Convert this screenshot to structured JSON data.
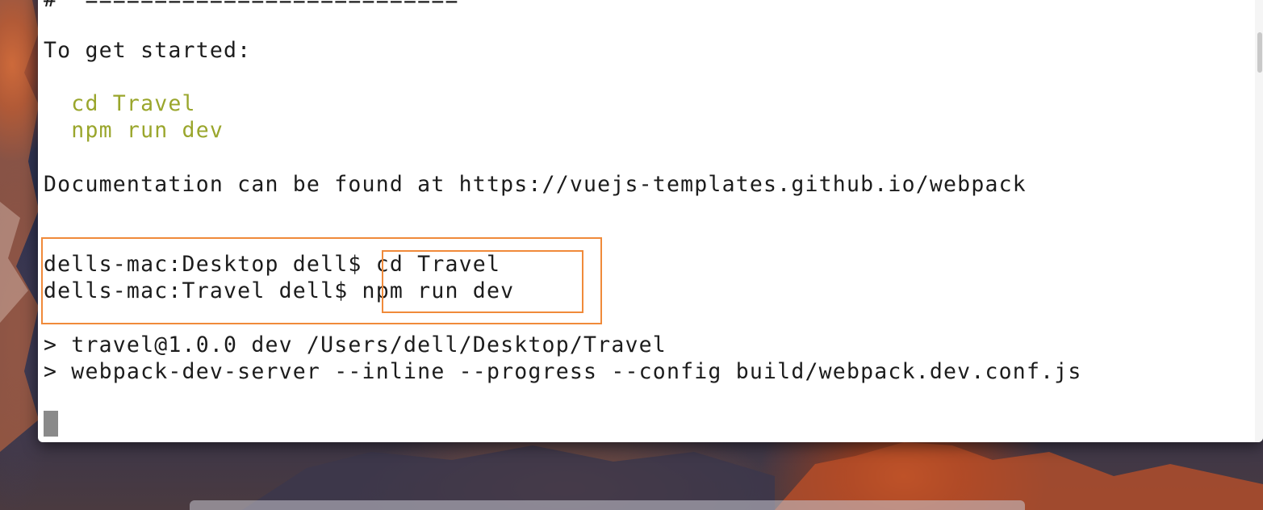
{
  "terminal": {
    "lines": [
      "#  ===========================",
      "To get started:",
      "  cd Travel",
      "  npm run dev",
      "Documentation can be found at https://vuejs-templates.github.io/webpack",
      "dells-mac:Desktop dell$ cd Travel",
      "dells-mac:Travel dell$ npm run dev",
      "> travel@1.0.0 dev /Users/dell/Desktop/Travel",
      "> webpack-dev-server --inline --progress --config build/webpack.dev.conf.js"
    ]
  },
  "colors": {
    "terminal_background": "#ffffff",
    "text": "#1c1c1c",
    "command_hint_green": "#9aa62c",
    "annotation_orange": "#f08a3a"
  }
}
